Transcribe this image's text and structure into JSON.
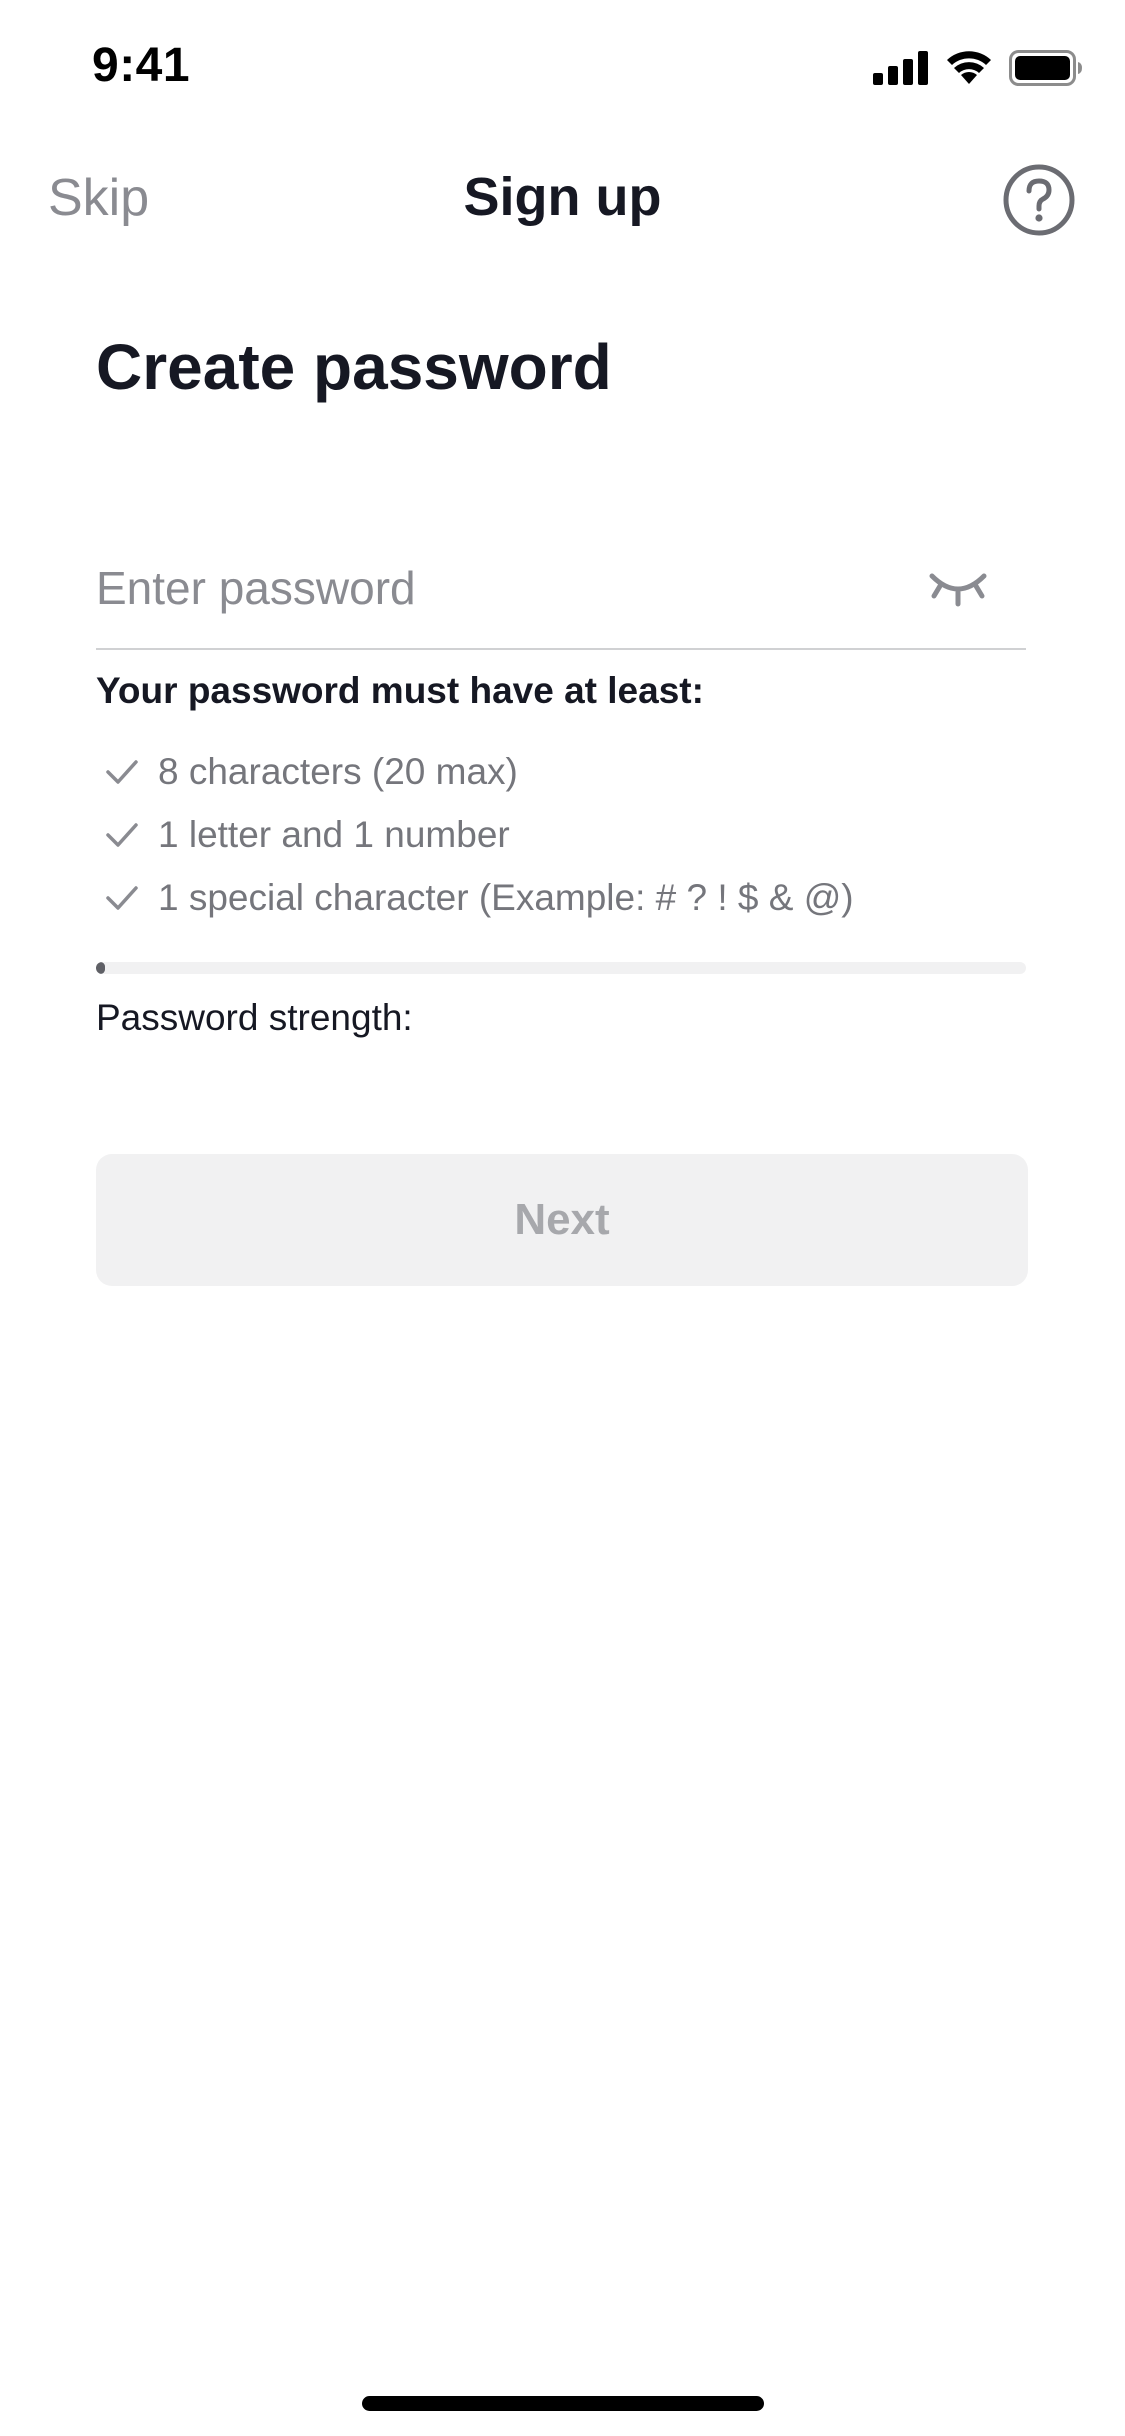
{
  "status_bar": {
    "time": "9:41"
  },
  "nav": {
    "skip_label": "Skip",
    "title": "Sign up",
    "help_icon": "question-circle-icon"
  },
  "main": {
    "heading": "Create password",
    "password_field": {
      "value": "",
      "placeholder": "Enter password",
      "toggle_icon": "eye-closed-icon"
    },
    "requirements_title": "Your password must have at least:",
    "requirements": [
      {
        "icon": "check-icon",
        "label": "8 characters (20 max)"
      },
      {
        "icon": "check-icon",
        "label": "1 letter and 1 number"
      },
      {
        "icon": "check-icon",
        "label": "1 special character (Example: # ? ! $ & @)"
      }
    ],
    "strength": {
      "label": "Password strength:",
      "level_fraction": 0.01
    },
    "next_label": "Next"
  },
  "colors": {
    "text_primary": "#161823",
    "text_secondary": "#75767c",
    "button_disabled_bg": "#f1f1f2",
    "button_disabled_text": "#a7a8ac"
  }
}
